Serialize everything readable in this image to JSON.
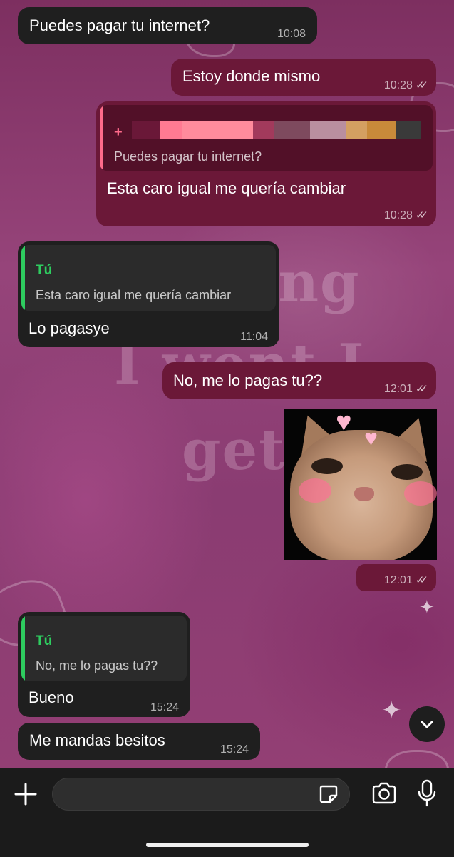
{
  "messages": [
    {
      "id": "m1",
      "direction": "incoming",
      "text": "Puedes pagar tu internet?",
      "time": "10:08"
    },
    {
      "id": "m2",
      "direction": "outgoing",
      "text": "Estoy donde mismo",
      "time": "10:28",
      "status": "read"
    },
    {
      "id": "m3",
      "direction": "outgoing",
      "quote_text": "Puedes pagar tu internet?",
      "text": "Esta caro igual me quería cambiar",
      "time": "10:28",
      "status": "read"
    },
    {
      "id": "m4",
      "direction": "incoming",
      "quote_author": "Tú",
      "quote_text": "Esta caro igual me quería cambiar",
      "text": "Lo pagasye",
      "time": "11:04"
    },
    {
      "id": "m5",
      "direction": "outgoing",
      "text": "No, me lo pagas tu??",
      "time": "12:01",
      "status": "read"
    },
    {
      "id": "m6",
      "direction": "outgoing",
      "type": "sticker",
      "time": "12:01",
      "status": "read"
    },
    {
      "id": "m7",
      "direction": "incoming",
      "quote_author": "Tú",
      "quote_text": "No, me lo pagas tu??",
      "text": "Bueno",
      "time": "15:24"
    },
    {
      "id": "m8",
      "direction": "incoming",
      "text": "Me mandas besitos",
      "time": "15:24"
    }
  ],
  "wallpaper_text": [
    "hing",
    "I went I",
    "get"
  ],
  "composer": {
    "placeholder": ""
  },
  "icons": {
    "attach": "plus-icon",
    "sticker": "sticker-icon",
    "camera": "camera-icon",
    "mic": "microphone-icon",
    "scroll": "chevron-down-icon",
    "read_receipt": "double-check-icon"
  },
  "colors": {
    "incoming_bubble": "#1f1f1f",
    "outgoing_bubble": "#6b1838",
    "quote_self_accent": "#2ecc5f",
    "quote_other_accent": "#ff6b8b",
    "input_bar": "#1b1b1b"
  }
}
